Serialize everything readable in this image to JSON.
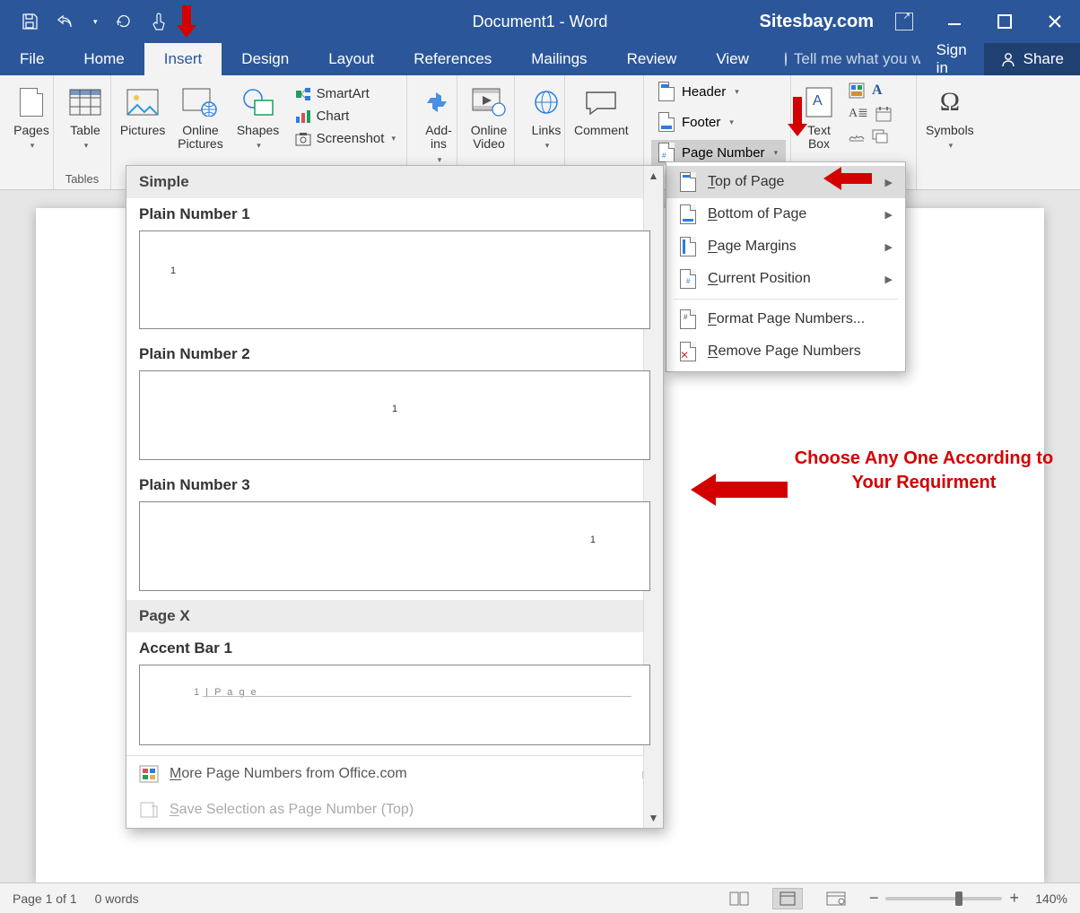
{
  "title": "Document1 - Word",
  "brand": "Sitesbay.com",
  "tabs": {
    "file": "File",
    "home": "Home",
    "insert": "Insert",
    "design": "Design",
    "layout": "Layout",
    "references": "References",
    "mailings": "Mailings",
    "review": "Review",
    "view": "View"
  },
  "tellme_placeholder": "Tell me what you want to d",
  "signin": "Sign in",
  "share": "Share",
  "ribbon": {
    "pages": "Pages",
    "tables_group": "Tables",
    "table": "Table",
    "pictures": "Pictures",
    "online_pictures": "Online\nPictures",
    "shapes": "Shapes",
    "smartart": "SmartArt",
    "chart": "Chart",
    "screenshot": "Screenshot",
    "addins": "Add-\nins",
    "online_video": "Online\nVideo",
    "links": "Links",
    "comment": "Comment",
    "header": "Header",
    "footer": "Footer",
    "page_number": "Page Number",
    "textbox": "Text\nBox",
    "symbols": "Symbols"
  },
  "submenu": {
    "top": "Top of Page",
    "bottom": "Bottom of Page",
    "margins": "Page Margins",
    "current": "Current Position",
    "format": "Format Page Numbers...",
    "remove": "Remove Page Numbers"
  },
  "gallery": {
    "simple": "Simple",
    "pn1": "Plain Number 1",
    "pn2": "Plain Number 2",
    "pn3": "Plain Number 3",
    "pagex": "Page X",
    "accent1": "Accent Bar 1",
    "accent_preview": "1 | P a g e",
    "more": "More Page Numbers from Office.com",
    "save_sel": "Save Selection as Page Number (Top)"
  },
  "annotation": {
    "choose": "Choose Any One According\nto Your Requirment"
  },
  "status": {
    "page": "Page 1 of 1",
    "words": "0 words",
    "zoom": "140%"
  }
}
